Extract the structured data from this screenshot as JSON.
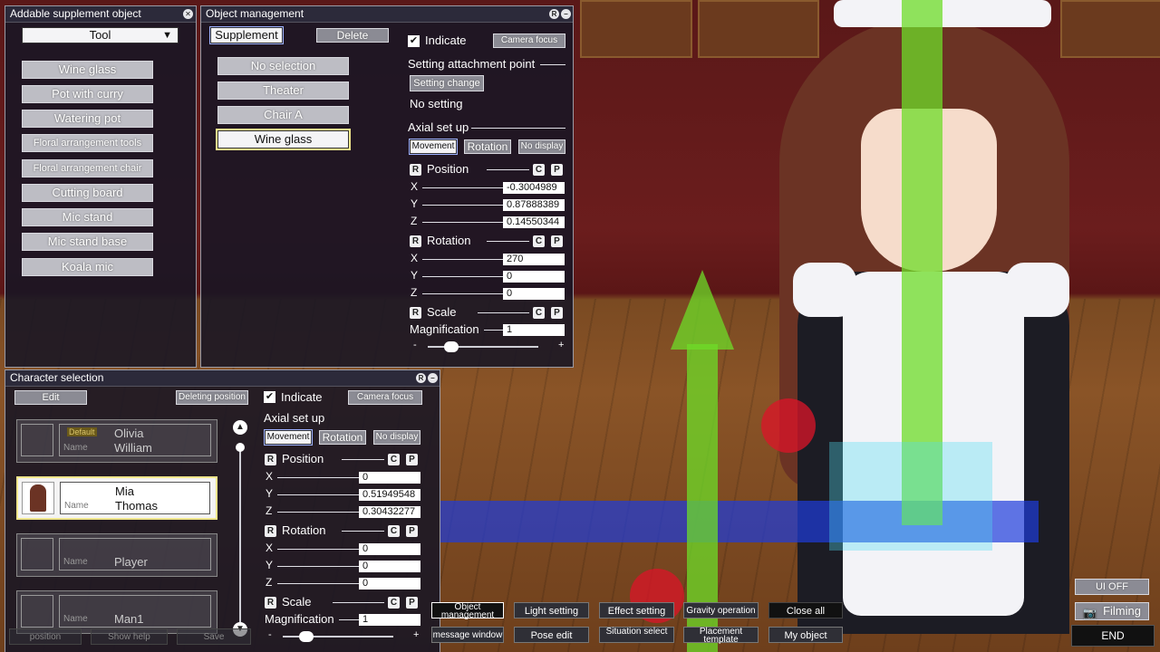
{
  "supplement_panel": {
    "title": "Addable supplement object",
    "dropdown_value": "Tool",
    "items": [
      "Wine glass",
      "Pot with curry",
      "Watering pot",
      "Floral arrangement tools",
      "Floral arrangement chair",
      "Cutting board",
      "Mic stand",
      "Mic stand base",
      "Koala mic"
    ]
  },
  "object_panel": {
    "title": "Object management",
    "tab_supplement": "Supplement",
    "delete": "Delete",
    "list": [
      "No selection",
      "Theater",
      "Chair A",
      "Wine glass"
    ],
    "selected_index": 3,
    "indicate": "Indicate",
    "camera_focus": "Camera focus",
    "attach_label": "Setting attachment point",
    "setting_change": "Setting change",
    "no_setting": "No setting",
    "axial_label": "Axial set up",
    "axis_buttons": [
      "Movement",
      "Rotation",
      "No display"
    ],
    "position_label": "Position",
    "rotation_label": "Rotation",
    "scale_label": "Scale",
    "magnification_label": "Magnification",
    "r": "R",
    "c": "C",
    "p": "P",
    "axes": [
      "X",
      "Y",
      "Z"
    ],
    "position": [
      "-0.3004989",
      "0.87888389",
      "0.14550344"
    ],
    "rotation": [
      "270",
      "0",
      "0"
    ],
    "magnification": "1",
    "minus": "-",
    "plus": "+"
  },
  "character_panel": {
    "title": "Character selection",
    "edit": "Edit",
    "deleting_position": "Deleting position",
    "indicate": "Indicate",
    "camera_focus": "Camera focus",
    "name_label": "Name",
    "characters": [
      {
        "first": "Olivia",
        "last": "William",
        "badge": "Default"
      },
      {
        "first": "Mia",
        "last": "Thomas",
        "badge": ""
      },
      {
        "first": "",
        "last": "Player",
        "badge": ""
      },
      {
        "first": "",
        "last": "Man1",
        "badge": ""
      }
    ],
    "selected_index": 1,
    "axial_label": "Axial set up",
    "axis_buttons": [
      "Movement",
      "Rotation",
      "No display"
    ],
    "position_label": "Position",
    "rotation_label": "Rotation",
    "scale_label": "Scale",
    "magnification_label": "Magnification",
    "position": [
      "0",
      "0.51949548",
      "0.30432277"
    ],
    "rotation": [
      "0",
      "0",
      "0"
    ],
    "magnification": "1"
  },
  "bottom_bar": {
    "row1": [
      "Object management",
      "Light setting",
      "Effect setting",
      "Gravity operation",
      "Close all"
    ],
    "row2": [
      "message window",
      "Pose edit",
      "Situation select",
      "Placement template",
      "My object"
    ],
    "partial_left": [
      "position",
      "Show help",
      "Save"
    ],
    "ui_off": "UI OFF",
    "filming": "Filming",
    "end": "END"
  },
  "colors": {
    "selected_outline": "#f0e68c",
    "panel_bg": "#18162400"
  }
}
